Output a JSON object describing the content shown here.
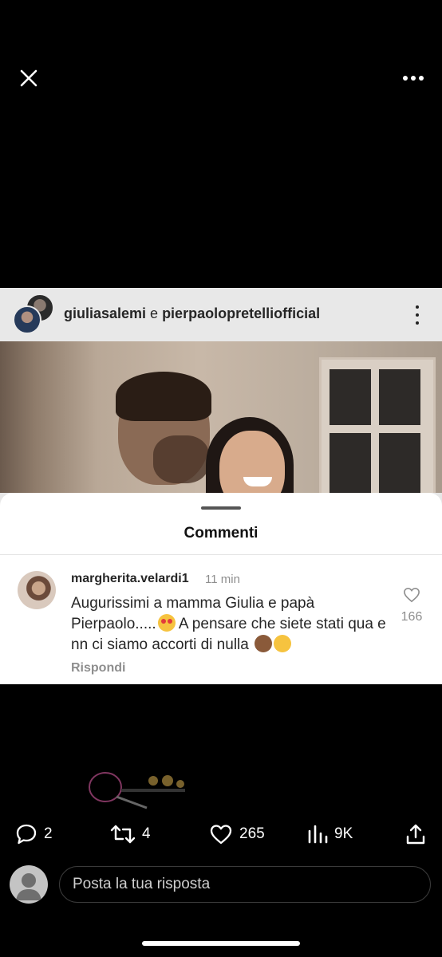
{
  "post": {
    "author1": "giuliasalemi",
    "connector": " e ",
    "author2": "pierpaolopretelliofficial"
  },
  "comments_sheet": {
    "title": "Commenti",
    "comment": {
      "username": "margherita.velardi1",
      "time": "11 min",
      "text_part1": "Augurissimi a mamma Giulia e papà Pierpaolo.....",
      "text_part2": " A pensare che siete stati qua e nn ci siamo accorti di nulla ",
      "likes": "166",
      "reply_label": "Rispondi"
    }
  },
  "actions": {
    "replies": "2",
    "reposts": "4",
    "likes": "265",
    "views": "9K"
  },
  "reply_bar": {
    "placeholder": "Posta la tua risposta"
  },
  "icons": [
    "close-icon",
    "more-icon",
    "comment-icon",
    "repost-icon",
    "heart-icon",
    "views-icon",
    "share-icon",
    "user-avatar-icon"
  ]
}
